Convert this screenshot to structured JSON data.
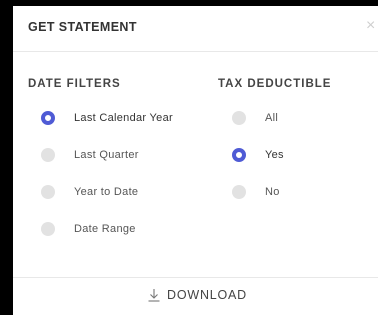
{
  "dialog": {
    "title": "GET STATEMENT",
    "close_icon": "close-icon",
    "close_glyph": "×"
  },
  "date_filters": {
    "heading": "DATE FILTERS",
    "options": [
      {
        "label": "Last Calendar Year",
        "selected": true
      },
      {
        "label": "Last Quarter",
        "selected": false
      },
      {
        "label": "Year to Date",
        "selected": false
      },
      {
        "label": "Date Range",
        "selected": false
      }
    ]
  },
  "tax_deductible": {
    "heading": "TAX DEDUCTIBLE",
    "options": [
      {
        "label": "All",
        "selected": false
      },
      {
        "label": "Yes",
        "selected": true
      },
      {
        "label": "No",
        "selected": false
      }
    ]
  },
  "footer": {
    "download_label": "DOWNLOAD",
    "download_icon": "download-icon"
  },
  "colors": {
    "accent": "#4f5bd5",
    "radio_unselected": "#e2e2e2",
    "backdrop": "#000000"
  }
}
